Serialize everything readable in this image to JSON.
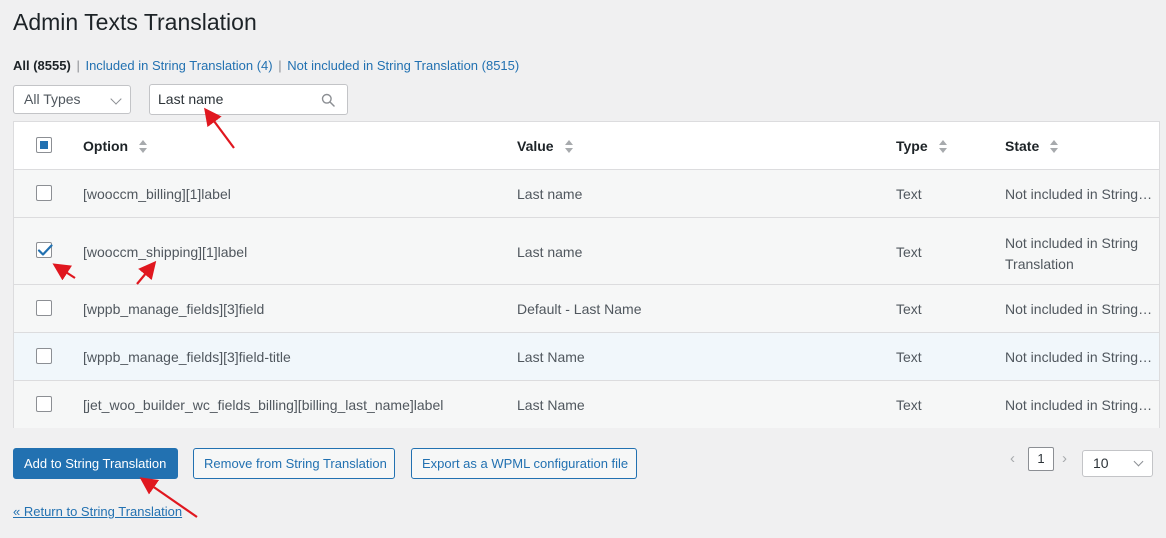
{
  "page": {
    "title": "Admin Texts Translation"
  },
  "filters": {
    "all_label": "All (8555)",
    "separator": "|",
    "included_label": "Included in String Translation (4)",
    "not_included_label": "Not included in String Translation (8515)"
  },
  "type_select": {
    "value": "All Types"
  },
  "search": {
    "value": "Last name",
    "icon": "search-icon"
  },
  "table": {
    "headers": {
      "option": "Option",
      "value": "Value",
      "type": "Type",
      "state": "State"
    },
    "rows": [
      {
        "checked": false,
        "option": "[wooccm_billing][1]label",
        "value": "Last name",
        "type": "Text",
        "state": "Not included in String Translation"
      },
      {
        "checked": true,
        "option": "[wooccm_shipping][1]label",
        "value": "Last name",
        "type": "Text",
        "state": "Not included in String Translation"
      },
      {
        "checked": false,
        "option": "[wppb_manage_fields][3]field",
        "value": "Default - Last Name",
        "type": "Text",
        "state": "Not included in String Translation"
      },
      {
        "checked": false,
        "option": "[wppb_manage_fields][3]field-title",
        "value": "Last Name",
        "type": "Text",
        "state": "Not included in String Translation"
      },
      {
        "checked": false,
        "option": "[jet_woo_builder_wc_fields_billing][billing_last_name]label",
        "value": "Last Name",
        "type": "Text",
        "state": "Not included in String Translation"
      }
    ]
  },
  "actions": {
    "add_label": "Add to String Translation",
    "remove_label": "Remove from String Translation",
    "export_label": "Export as a WPML configuration file"
  },
  "pagination": {
    "prev": "‹",
    "current_page": "1",
    "next": "›",
    "per_page": "10"
  },
  "footer": {
    "return_label": "« Return to String Translation"
  },
  "colors": {
    "accent": "#2271b1",
    "annotation_arrow": "#e0171f"
  }
}
